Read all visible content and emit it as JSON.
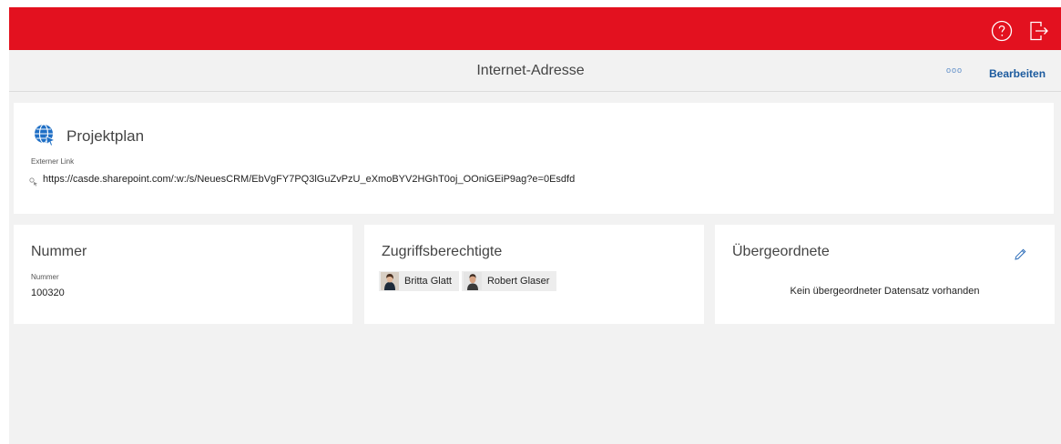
{
  "header": {
    "help_icon": "help-circle-icon",
    "logout_icon": "logout-icon",
    "brand_color": "#e3111f"
  },
  "titlebar": {
    "title": "Internet-Adresse",
    "more_label": "ooo",
    "edit_label": "Bearbeiten"
  },
  "link_card": {
    "icon": "globe-link-icon",
    "name": "Projektplan",
    "label": "Externer Link",
    "url": "https://casde.sharepoint.com/:w:/s/NeuesCRM/EbVgFY7PQ3lGuZvPzU_eXmoBYV2HGhT0oj_OOniGEiP9ag?e=0Esdfd"
  },
  "nummer_card": {
    "title": "Nummer",
    "label": "Nummer",
    "value": "100320"
  },
  "access_card": {
    "title": "Zugriffsberechtigte",
    "users": [
      {
        "name": "Britta Glatt"
      },
      {
        "name": "Robert Glaser"
      }
    ]
  },
  "parent_card": {
    "title": "Übergeordnete",
    "empty_text": "Kein übergeordneter Datensatz vorhanden"
  }
}
